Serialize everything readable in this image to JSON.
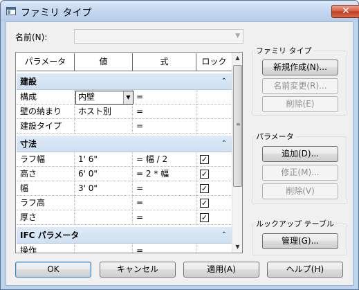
{
  "window": {
    "title": "ファミリ タイプ",
    "close_label": "✕"
  },
  "name_field": {
    "label": "名前(N):",
    "value": ""
  },
  "grid": {
    "columns": [
      "パラメータ",
      "値",
      "式",
      "ロック"
    ],
    "groups": [
      {
        "title": "建設",
        "rows": [
          {
            "param": "構成",
            "value": "内壁",
            "formula": "=",
            "lock": null,
            "editing": true
          },
          {
            "param": "壁の納まり",
            "value": "ホスト別",
            "formula": "=",
            "lock": null
          },
          {
            "param": "建設タイプ",
            "value": "",
            "formula": "=",
            "lock": null
          }
        ]
      },
      {
        "title": "寸法",
        "rows": [
          {
            "param": "ラフ幅",
            "value": "1'  6\"",
            "formula": "= 幅 / 2",
            "lock": true
          },
          {
            "param": "高さ",
            "value": "6'  0\"",
            "formula": "= 2 * 幅",
            "lock": true
          },
          {
            "param": "幅",
            "value": "3'  0\"",
            "formula": "=",
            "lock": true
          },
          {
            "param": "ラフ高",
            "value": "",
            "formula": "=",
            "lock": true
          },
          {
            "param": "厚さ",
            "value": "",
            "formula": "=",
            "lock": true
          }
        ]
      },
      {
        "title": "IFC パラメータ",
        "rows": [
          {
            "param": "操作",
            "value": "",
            "formula": "=",
            "lock": null
          }
        ]
      }
    ]
  },
  "family_types": {
    "legend": "ファミリ タイプ",
    "new_label": "新規作成(N)...",
    "rename_label": "名前変更(R)...",
    "delete_label": "削除(E)"
  },
  "parameters": {
    "legend": "パラメータ",
    "add_label": "追加(D)...",
    "modify_label": "修正(M)...",
    "remove_label": "削除(V)"
  },
  "lookup": {
    "legend": "ルックアップ テーブル",
    "manage_label": "管理(G)..."
  },
  "footer": {
    "ok_label": "OK",
    "cancel_label": "キャンセル",
    "apply_label": "適用(A)",
    "help_label": "ヘルプ(H)"
  }
}
